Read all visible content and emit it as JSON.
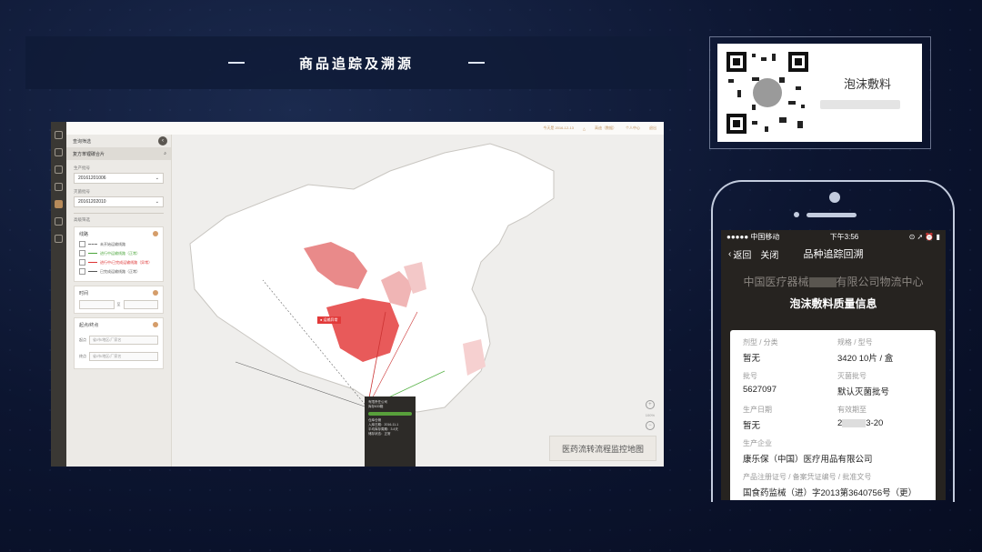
{
  "slide": {
    "title": "商品追踪及溯源"
  },
  "desktop": {
    "topbar": {
      "items": [
        "今天是 2016-12-13",
        "高迪（数据）",
        "个人中心",
        "退出"
      ]
    },
    "sidebar": {
      "header": "查询筛选",
      "search_label": "复方苯锂碳合片",
      "production_batch_label": "生产批号",
      "production_batch_value": "20161201006",
      "sterile_batch_label": "灭菌批号",
      "sterile_batch_value": "20161202010",
      "filter_section": "高级筛选",
      "route_card": {
        "title": "线路",
        "items": [
          "未开始运输线路",
          "进行中运输线路（正常）",
          "进行中/已完成运输线路（异常）",
          "已完成运输线路（正常）"
        ]
      },
      "time_card": {
        "title": "时间",
        "to": "至"
      },
      "origin_card": {
        "title": "起点/终点",
        "from_label": "起点",
        "from_placeholder": "省/市/地区/厂家名",
        "to_label": "终点",
        "to_placeholder": "省/市/地区/厂家名"
      }
    },
    "map": {
      "overlay_label": "医药流转流程监控地图",
      "tag_label": "● 运输异常",
      "zoom_level": "100%",
      "popup": {
        "company": "有限责任公司",
        "stock": "库存633箱",
        "warehouse": "仓库仓储",
        "in_date": "入库日期：2016-11-1",
        "avg_days": "平均库存周期：3.4天",
        "status": "储存状态：正常"
      }
    }
  },
  "qr": {
    "name": "泡沫敷料"
  },
  "phone": {
    "status": {
      "carrier": "●●●●● 中国移动",
      "time": "下午3:56"
    },
    "nav": {
      "back": "返回",
      "close": "关闭",
      "title": "品种追踪回溯"
    },
    "hero": {
      "corp_prefix": "中国医疗器械",
      "corp_suffix": "有限公司物流中心",
      "quality_title": "泡沫敷料质量信息"
    },
    "fields": [
      {
        "key": "剂型 / 分类",
        "value": "暂无"
      },
      {
        "key": "规格 / 型号",
        "value": "3420 10片 / 盒"
      },
      {
        "key": "批号",
        "value": "5627097"
      },
      {
        "key": "灭菌批号",
        "value": "默认灭菌批号"
      },
      {
        "key": "生产日期",
        "value": "暂无"
      },
      {
        "key": "有效期至",
        "value_prefix": "2",
        "value_suffix": "3-20"
      }
    ],
    "manufacturer": {
      "key": "生产企业",
      "value": "康乐保（中国）医疗用品有限公司"
    },
    "registration": {
      "key": "产品注册证号 / 备案凭证编号 / 批准文号",
      "value": "国食药监械（进）字2013第3640756号（更）"
    }
  }
}
